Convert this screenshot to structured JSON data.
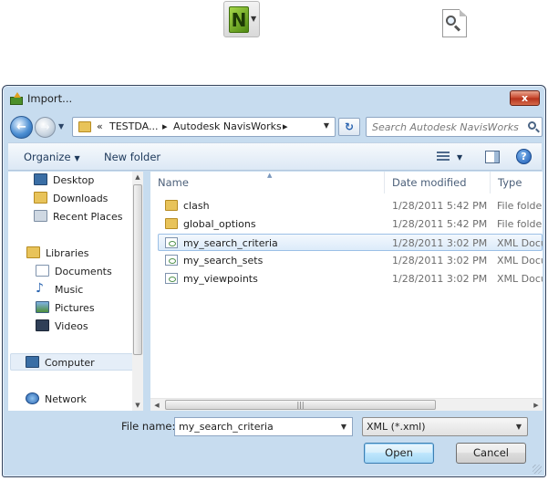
{
  "dialog": {
    "title": "Import...",
    "close_label": "x"
  },
  "navigation": {
    "back_label": "←",
    "forward_label": "→",
    "breadcrumb": {
      "overflow": "«",
      "parts": [
        "TESTDA...",
        "Autodesk NavisWorks"
      ]
    },
    "refresh_label": "↻",
    "search_placeholder": "Search Autodesk NavisWorks"
  },
  "toolbar": {
    "organize_label": "Organize",
    "new_folder_label": "New folder",
    "help_label": "?"
  },
  "sidebar": {
    "items": [
      {
        "label": "Desktop",
        "icon": "desktop-icon"
      },
      {
        "label": "Downloads",
        "icon": "downloads-folder-icon"
      },
      {
        "label": "Recent Places",
        "icon": "recent-places-icon"
      },
      {
        "label": "Libraries",
        "icon": "libraries-icon"
      },
      {
        "label": "Documents",
        "icon": "documents-icon"
      },
      {
        "label": "Music",
        "icon": "music-icon"
      },
      {
        "label": "Pictures",
        "icon": "pictures-icon"
      },
      {
        "label": "Videos",
        "icon": "videos-icon"
      },
      {
        "label": "Computer",
        "icon": "computer-icon"
      },
      {
        "label": "Network",
        "icon": "network-icon"
      }
    ]
  },
  "files": {
    "columns": [
      "Name",
      "Date modified",
      "Type"
    ],
    "rows": [
      {
        "name": "clash",
        "date": "1/28/2011 5:42 PM",
        "type": "File folder",
        "icon": "folder-icon"
      },
      {
        "name": "global_options",
        "date": "1/28/2011 5:42 PM",
        "type": "File folder",
        "icon": "folder-icon"
      },
      {
        "name": "my_search_criteria",
        "date": "1/28/2011 3:02 PM",
        "type": "XML Docu",
        "icon": "xml-file-icon"
      },
      {
        "name": "my_search_sets",
        "date": "1/28/2011 3:02 PM",
        "type": "XML Docu",
        "icon": "xml-file-icon"
      },
      {
        "name": "my_viewpoints",
        "date": "1/28/2011 3:02 PM",
        "type": "XML Docu",
        "icon": "xml-file-icon"
      }
    ],
    "selected_index": 2
  },
  "footer": {
    "file_name_label": "File name:",
    "file_name_value": "my_search_criteria",
    "file_type_value": "XML (*.xml)",
    "open_label": "Open",
    "cancel_label": "Cancel"
  },
  "colors": {
    "accent": "#3c7fb1",
    "selection": "#dcebfa",
    "close_button": "#c7452b"
  }
}
